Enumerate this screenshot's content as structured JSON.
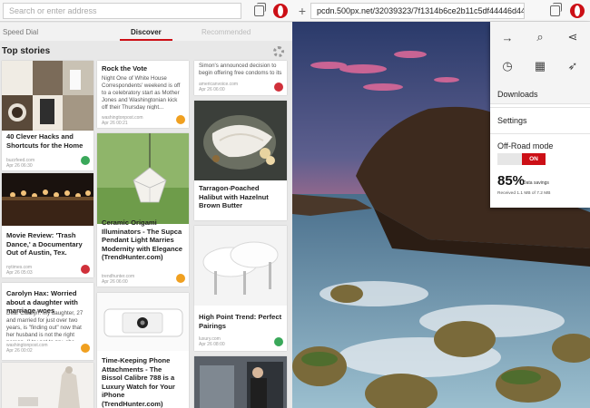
{
  "left": {
    "address_placeholder": "Search or enter address",
    "tabs": {
      "speed_dial": "Speed Dial",
      "discover": "Discover",
      "faded": "Recommended"
    },
    "section_title": "Top stories",
    "cards": [
      {
        "title": "",
        "desc": "",
        "src": ""
      },
      {
        "title": "40 Clever Hacks and Shortcuts for the Home",
        "desc": "",
        "src": "buzzfeed.com\nApr 26 06:30"
      },
      {
        "title": "Movie Review: 'Trash Dance,' a Documentary Out of Austin, Tex.",
        "desc": "",
        "src": "nytimes.com\nApr 26 05:03"
      },
      {
        "title": "Carolyn Hax: Worried about a daughter with marriage woes",
        "desc": "Dear Carolyn: My daughter, 27 and married for just over two years, is \"finding out\" now that her husband is not the right person. (I try not to pry, she said.) Is that a...",
        "src": "washingtonpost.com\nApr 26 00:02"
      },
      {
        "title": "Rock the Vote",
        "desc": "Night One of White House Correspondents' weekend is off to a celebratory start as Mother Jones and Washingtonian kick off their Thursday night...",
        "src": "washingtonpost.com\nApr 26 00:21"
      },
      {
        "title": "Ceramic Origami Illuminators - The Supca Pendant Light Marries Modernity with Elegance (TrendHunter.com)",
        "desc": "",
        "src": "trendhunter.com\nApr 26 06:00"
      },
      {
        "title": "Time-Keeping Phone Attachments - The Bissol Calibre 788 is a Luxury Watch for Your iPhone (TrendHunter.com)",
        "desc": "",
        "src": ""
      },
      {
        "title": "",
        "desc": "Simon's announced decision to begin offering free condoms to its students.",
        "src": "americanvoice.com\nApr 26 06:00"
      },
      {
        "title": "Tarragon-Poached Halibut with Hazelnut Brown Butter",
        "desc": "",
        "src": "epicurious.com\nApr 26 06:00"
      },
      {
        "title": "High Point Trend: Perfect Pairings",
        "desc": "",
        "src": "luxury.com\nApr 26 08:00"
      },
      {
        "title": "",
        "desc": "",
        "src": ""
      }
    ]
  },
  "right": {
    "address": "pcdn.500px.net/32039323/7f1314b6ce2b11c5df44446d446636b2/",
    "menu": {
      "downloads": "Downloads",
      "settings": "Settings",
      "offroad_label": "Off-Road mode",
      "offroad_state": "ON",
      "savings_pct": "85%",
      "savings_label": "Data savings",
      "received": "Received 1.1 MB of 7.2 MB"
    }
  },
  "colors": {
    "accent": "#cc0f16"
  }
}
